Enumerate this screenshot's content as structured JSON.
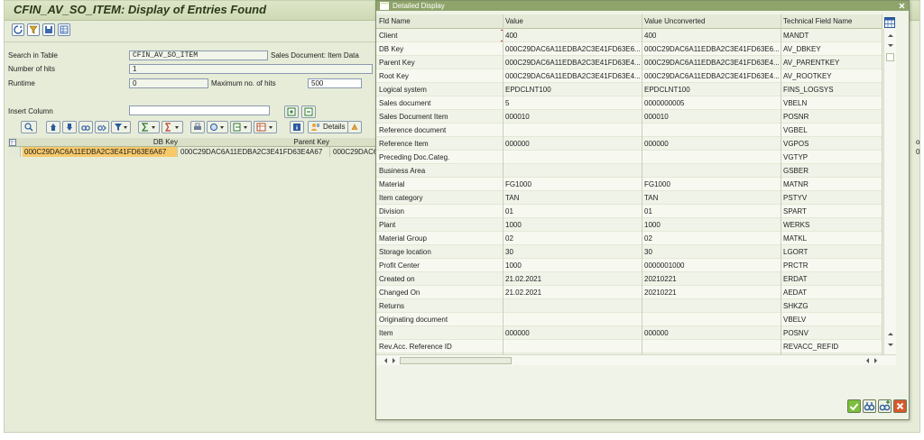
{
  "main": {
    "title": "CFIN_AV_SO_ITEM: Display of Entries Found",
    "fields": {
      "search_in_table_label": "Search in Table",
      "search_in_table_value": "CFIN_AV_SO_ITEM",
      "table_description": "Sales Document: Item Data",
      "number_of_hits_label": "Number of hits",
      "number_of_hits_value": "1",
      "runtime_label": "Runtime",
      "runtime_value": "0",
      "max_hits_label": "Maximum no. of hits",
      "max_hits_value": "500",
      "insert_column_label": "Insert Column",
      "insert_column_value": ""
    },
    "alv": {
      "details_label": "Details"
    },
    "grid": {
      "headers": [
        "DB Key",
        "Parent Key",
        "o"
      ],
      "row": [
        "000C29DAC6A11EDBA2C3E41FD63E6A67",
        "000C29DAC6A11EDBA2C3E41FD63E4A67",
        "000C29DAC6",
        "0"
      ]
    }
  },
  "popup": {
    "title": "Detailed Display",
    "columns": [
      "Fld Name",
      "Value",
      "Value Unconverted",
      "Technical Field Name"
    ],
    "rows": [
      [
        "Client",
        "400",
        "400",
        "MANDT"
      ],
      [
        "DB Key",
        "000C29DAC6A11EDBA2C3E41FD63E6...",
        "000C29DAC6A11EDBA2C3E41FD63E6...",
        "AV_DBKEY"
      ],
      [
        "Parent Key",
        "000C29DAC6A11EDBA2C3E41FD63E4...",
        "000C29DAC6A11EDBA2C3E41FD63E4...",
        "AV_PARENTKEY"
      ],
      [
        "Root Key",
        "000C29DAC6A11EDBA2C3E41FD63E4...",
        "000C29DAC6A11EDBA2C3E41FD63E4...",
        "AV_ROOTKEY"
      ],
      [
        "Logical system",
        "EPDCLNT100",
        "EPDCLNT100",
        "FINS_LOGSYS"
      ],
      [
        "Sales document",
        "5",
        "0000000005",
        "VBELN"
      ],
      [
        "Sales Document Item",
        "000010",
        "000010",
        "POSNR"
      ],
      [
        "Reference document",
        "",
        "",
        "VGBEL"
      ],
      [
        "Reference Item",
        "000000",
        "000000",
        "VGPOS"
      ],
      [
        "Preceding Doc.Categ.",
        "",
        "",
        "VGTYP"
      ],
      [
        "Business Area",
        "",
        "",
        "GSBER"
      ],
      [
        "Material",
        "FG1000",
        "FG1000",
        "MATNR"
      ],
      [
        "Item category",
        "TAN",
        "TAN",
        "PSTYV"
      ],
      [
        "Division",
        "01",
        "01",
        "SPART"
      ],
      [
        "Plant",
        "1000",
        "1000",
        "WERKS"
      ],
      [
        "Material Group",
        "02",
        "02",
        "MATKL"
      ],
      [
        "Storage location",
        "30",
        "30",
        "LGORT"
      ],
      [
        "Profit Center",
        "1000",
        "0000001000",
        "PRCTR"
      ],
      [
        "Created on",
        "21.02.2021",
        "20210221",
        "ERDAT"
      ],
      [
        "Changed On",
        "21.02.2021",
        "20210221",
        "AEDAT"
      ],
      [
        "Returns",
        "",
        "",
        "SHKZG"
      ],
      [
        "Originating document",
        "",
        "",
        "VBELV"
      ],
      [
        "Item",
        "000000",
        "000000",
        "POSNV"
      ],
      [
        "Rev.Acc. Reference ID",
        "",
        "",
        "REVACC_REFID"
      ]
    ]
  },
  "colors": {
    "window_bg": "#e6ecd8",
    "popup_title_bg": "#8fa46a",
    "highlight_cell": "#f7c96b",
    "ok_button": "#7bbf3a",
    "cancel_button": "#d9572b"
  }
}
